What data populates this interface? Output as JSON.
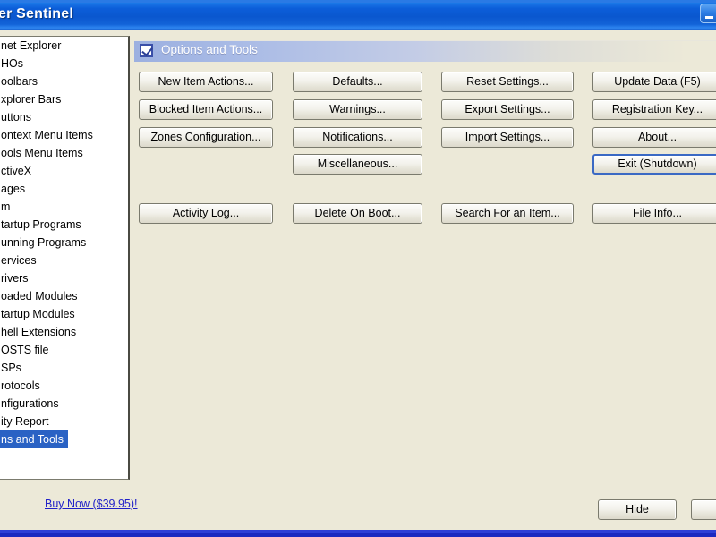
{
  "window": {
    "title": "er Sentinel",
    "minimize_label": "Minimize"
  },
  "sidebar": {
    "items": [
      {
        "label": "net Explorer",
        "selected": false
      },
      {
        "label": "HOs",
        "selected": false
      },
      {
        "label": "oolbars",
        "selected": false
      },
      {
        "label": "xplorer Bars",
        "selected": false
      },
      {
        "label": "uttons",
        "selected": false
      },
      {
        "label": "ontext Menu Items",
        "selected": false
      },
      {
        "label": "ools Menu Items",
        "selected": false
      },
      {
        "label": "ctiveX",
        "selected": false
      },
      {
        "label": "ages",
        "selected": false
      },
      {
        "label": "m",
        "selected": false
      },
      {
        "label": "tartup Programs",
        "selected": false
      },
      {
        "label": "unning Programs",
        "selected": false
      },
      {
        "label": "ervices",
        "selected": false
      },
      {
        "label": "rivers",
        "selected": false
      },
      {
        "label": "oaded Modules",
        "selected": false
      },
      {
        "label": "tartup Modules",
        "selected": false
      },
      {
        "label": "hell Extensions",
        "selected": false
      },
      {
        "label": "OSTS file",
        "selected": false
      },
      {
        "label": "SPs",
        "selected": false
      },
      {
        "label": "rotocols",
        "selected": false
      },
      {
        "label": "nfigurations",
        "selected": false
      },
      {
        "label": "ity Report",
        "selected": false
      },
      {
        "label": "ns and Tools",
        "selected": true
      }
    ]
  },
  "content": {
    "section_title": "Options and Tools",
    "checkbox_icon": "checkbox-checked-icon",
    "buttons": {
      "new_item_actions": "New Item Actions...",
      "blocked_item_actions": "Blocked Item Actions...",
      "zones_configuration": "Zones Configuration...",
      "defaults": "Defaults...",
      "warnings": "Warnings...",
      "notifications": "Notifications...",
      "miscellaneous": "Miscellaneous...",
      "reset_settings": "Reset Settings...",
      "export_settings": "Export Settings...",
      "import_settings": "Import Settings...",
      "update_data": "Update Data (F5)",
      "registration_key": "Registration Key...",
      "about": "About...",
      "exit_shutdown": "Exit (Shutdown)",
      "activity_log": "Activity Log...",
      "delete_on_boot": "Delete On Boot...",
      "search_for_an_item": "Search For an Item...",
      "file_info": "File Info..."
    }
  },
  "footer": {
    "buy_now": "Buy Now ($39.95)!",
    "hide": "Hide",
    "clipped_button": ""
  },
  "colors": {
    "titlebar_blue": "#0a57cf",
    "panel_beige": "#ece9d8",
    "selection_blue": "#2a62c4",
    "link_blue": "#2020c8",
    "focus_border": "#3a69c4",
    "bottom_strip": "#1a29c0"
  }
}
